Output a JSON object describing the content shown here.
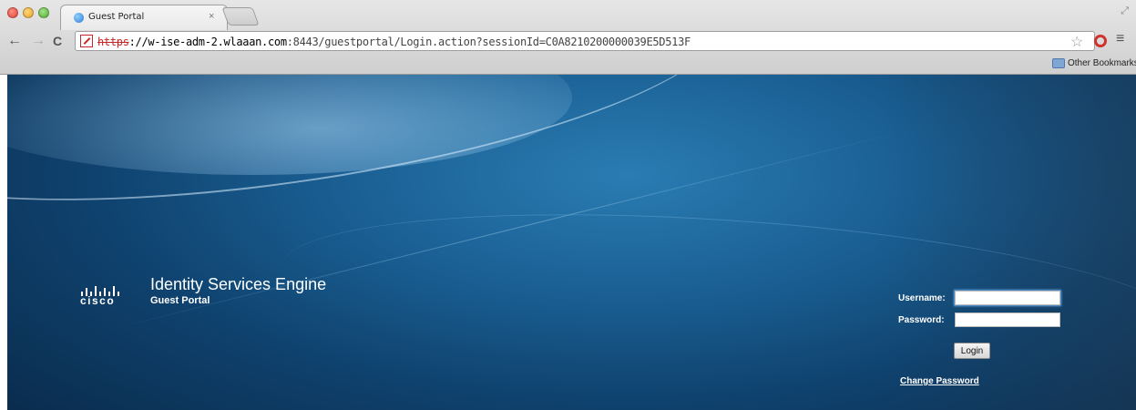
{
  "browser": {
    "tab_title": "Guest Portal",
    "tab_close": "×",
    "url_scheme": "https",
    "url_host": "://w-ise-adm-2.wlaaan.com",
    "url_rest": ":8443/guestportal/Login.action?sessionId=C0A8210200000039E5D513F",
    "back_icon": "←",
    "forward_icon": "→",
    "reload_icon": "C",
    "star_icon": "☆",
    "menu_icon": "≡",
    "bookmark_folder": "Other Bookmarks"
  },
  "brand": {
    "logo_text": "cisco",
    "product_name": "Identity Services Engine",
    "portal_name": "Guest Portal"
  },
  "login": {
    "username_label": "Username:",
    "password_label": "Password:",
    "username_value": "",
    "password_value": "",
    "login_button": "Login",
    "change_password_link": "Change Password"
  },
  "colors": {
    "page_background": "#1a5f93",
    "security_warning": "#c62828"
  }
}
